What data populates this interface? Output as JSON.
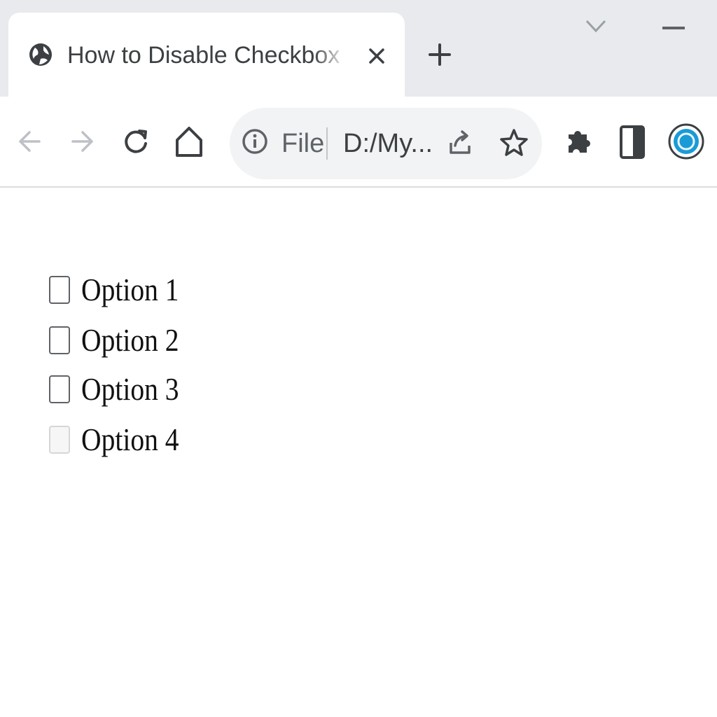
{
  "browser": {
    "tab": {
      "title": "How to Disable Checkbox using",
      "close_icon": "close-icon",
      "favicon": "globe-icon"
    },
    "new_tab_icon": "plus-icon",
    "toolbar": {
      "back_icon": "arrow-left-icon",
      "forward_icon": "arrow-right-icon",
      "reload_icon": "reload-icon",
      "home_icon": "home-icon"
    },
    "omnibox": {
      "info_icon": "info-icon",
      "scheme_label": "File",
      "url_text": "D:/My..."
    },
    "colors": {
      "tabstrip": "#e8eaed",
      "toolbar": "#ffffff",
      "omnibox": "#f1f3f4",
      "profile_accent": "#1a9bd6"
    }
  },
  "page": {
    "options": [
      {
        "label": "Option 1",
        "checked": false,
        "disabled": false
      },
      {
        "label": "Option 2",
        "checked": false,
        "disabled": false
      },
      {
        "label": "Option 3",
        "checked": false,
        "disabled": false
      },
      {
        "label": "Option 4",
        "checked": false,
        "disabled": true
      }
    ]
  }
}
